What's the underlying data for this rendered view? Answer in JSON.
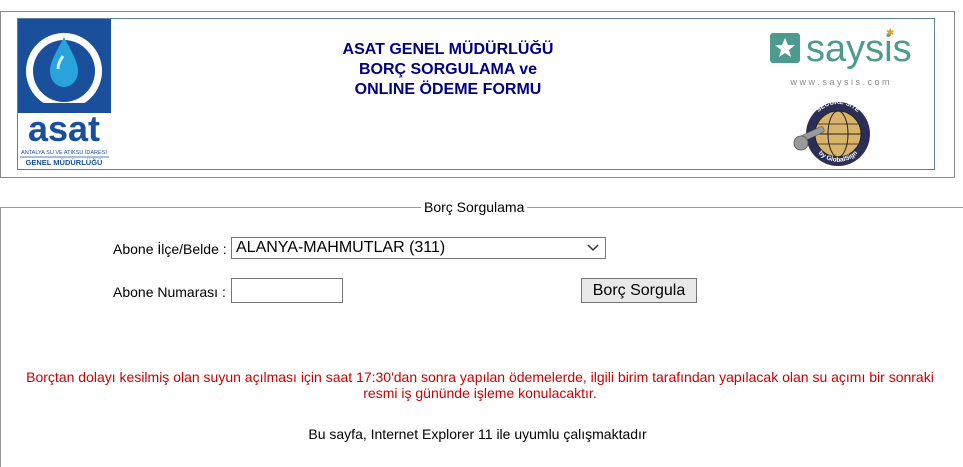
{
  "header": {
    "title_lines": [
      "ASAT GENEL MÜDÜRLÜĞÜ",
      "BORÇ SORGULAMA ve",
      "ONLINE ÖDEME FORMU"
    ],
    "asat_logo": {
      "brand": "asat",
      "subline": "ANTALYA SU VE ATIKSU İDARESİ",
      "org": "GENEL MÜDÜRLÜĞÜ"
    },
    "saysis_logo": {
      "brand": "saysis",
      "url": "w w w . s a y s i s . c o m"
    },
    "seal": {
      "top": "SECURE SITE",
      "bottom": "by GlobalSign"
    }
  },
  "form": {
    "legend": "Borç Sorgulama",
    "district_label": "Abone İlçe/Belde :",
    "district_value": "ALANYA-MAHMUTLAR (311)",
    "subscriber_label": "Abone Numarası :",
    "subscriber_value": "",
    "submit_label": "Borç Sorgula"
  },
  "notice": "Borçtan dolayı kesilmiş olan suyun açılması için saat 17:30'dan sonra yapılan ödemelerde, ilgili birim tarafından yapılacak olan su açımı bir sonraki resmi iş gününde işleme konulacaktır.",
  "footer": "Bu sayfa, Internet Explorer 11 ile uyumlu çalışmaktadır",
  "colors": {
    "title": "#000080",
    "notice": "#cc0000",
    "asat_blue": "#1a4f9c"
  }
}
